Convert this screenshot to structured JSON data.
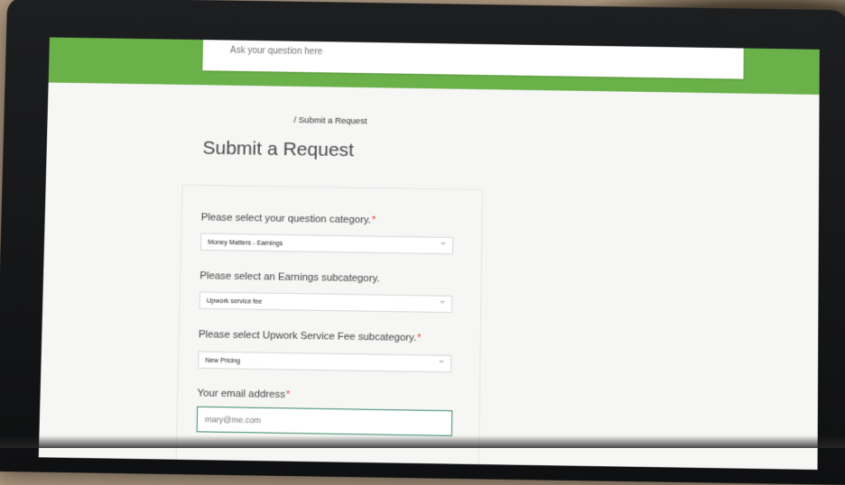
{
  "search": {
    "placeholder": "Ask your question here"
  },
  "breadcrumb": {
    "separator": "/",
    "current": "Submit a Request"
  },
  "page": {
    "title": "Submit a Request"
  },
  "form": {
    "category": {
      "label": "Please select your question category.",
      "required_mark": "*",
      "value": "Money Matters - Earnings"
    },
    "subcategory": {
      "label": "Please select an Earnings subcategory.",
      "value": "Upwork service fee"
    },
    "fee_subcategory": {
      "label": "Please select Upwork Service Fee subcategory.",
      "required_mark": "*",
      "value": "New Pricing"
    },
    "email": {
      "label": "Your email address",
      "required_mark": "*",
      "placeholder": "mary@me.com"
    }
  },
  "colors": {
    "brand_green": "#6bb14a",
    "focus_border": "#3e8a6c",
    "required": "#e24b3c"
  }
}
